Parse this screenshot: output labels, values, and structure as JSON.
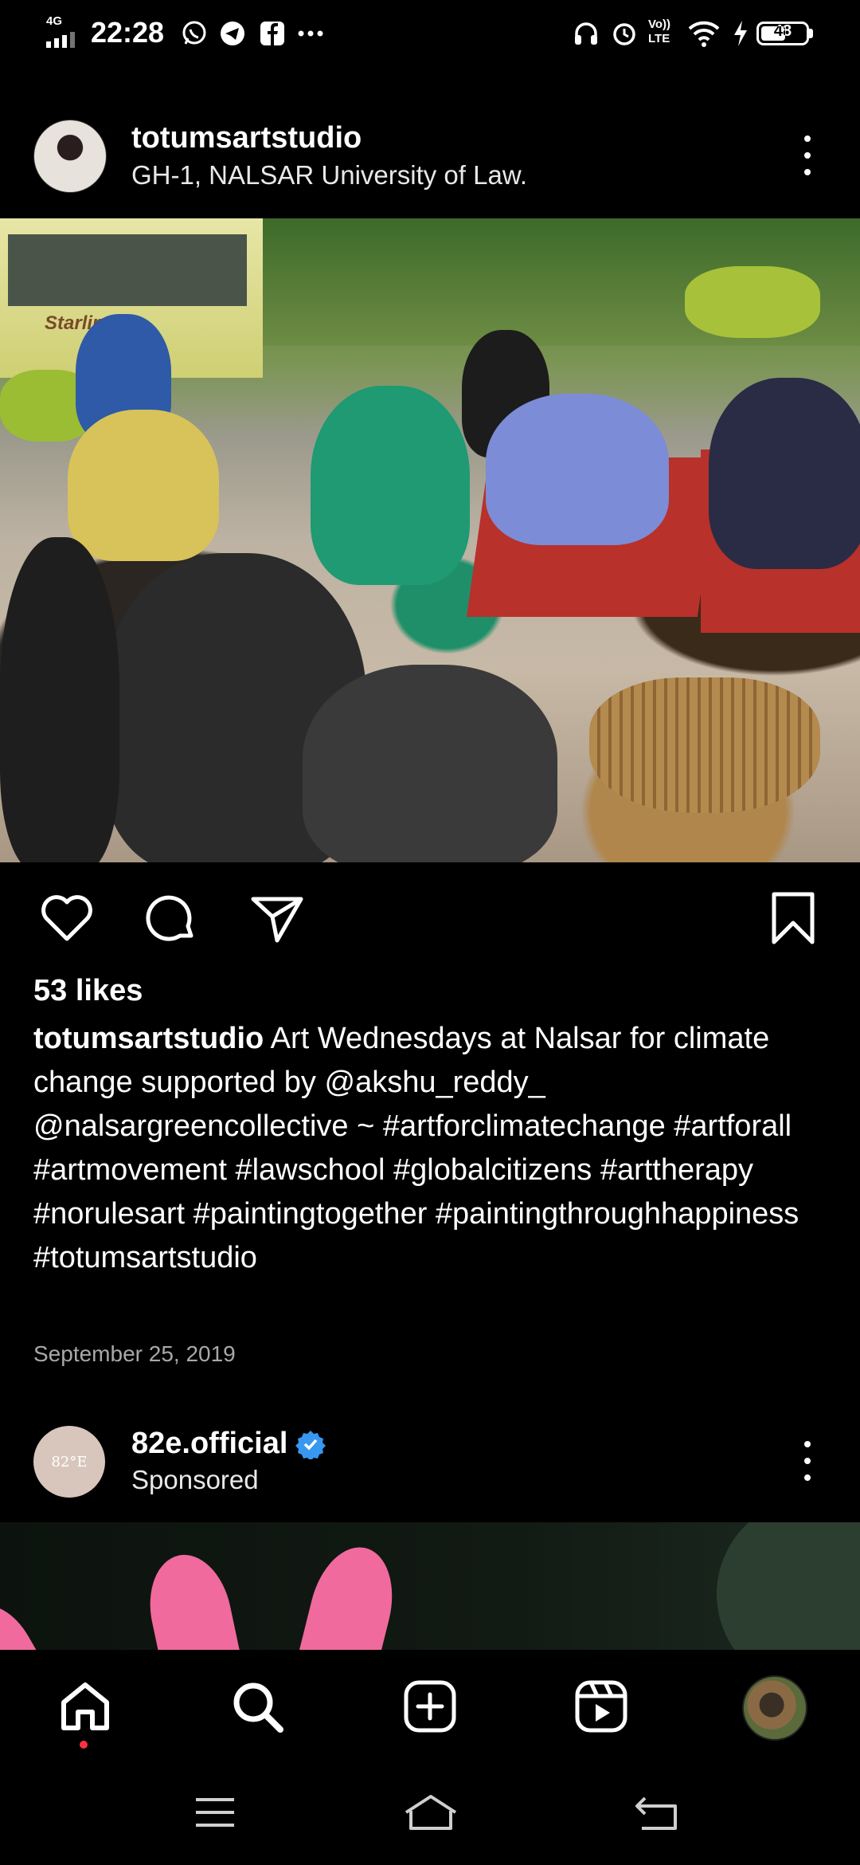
{
  "status_bar": {
    "time": "22:28",
    "network_label": "4G",
    "battery": "48",
    "icons": [
      "whatsapp-icon",
      "telegram-icon",
      "facebook-icon",
      "more-notifications-icon",
      "headphones-icon",
      "alarm-icon",
      "volte-icon",
      "wifi-icon",
      "charging-icon",
      "battery-icon"
    ],
    "volte_label_top": "Vo))",
    "volte_label_bottom": "LTE"
  },
  "post": {
    "username": "totumsartstudio",
    "location": "GH-1, NALSAR University of Law.",
    "image_text": {
      "bus_brand": "Starline"
    },
    "likes": "53 likes",
    "caption_user": "totumsartstudio",
    "caption_text": " Art Wednesdays at Nalsar for climate change supported by @akshu_reddy_ @nalsargreencollective ~ #artforclimatechange #artforall #artmovement #lawschool #globalcitizens #arttherapy #norulesart #paintingtogether #paintingthroughhappiness #totumsartstudio",
    "date": "September 25, 2019"
  },
  "sponsored_post": {
    "username": "82e.official",
    "label": "Sponsored",
    "avatar_text": "82°E",
    "verified": true
  },
  "colors": {
    "background": "#000000",
    "text": "#ffffff",
    "muted": "#a8a8a8",
    "verified_blue": "#3897f0",
    "notification_dot": "#ff3040"
  },
  "bottom_nav": [
    "home-icon",
    "search-icon",
    "create-icon",
    "reels-icon",
    "profile-avatar"
  ],
  "system_nav": [
    "menu-icon",
    "home-button-icon",
    "back-icon"
  ]
}
